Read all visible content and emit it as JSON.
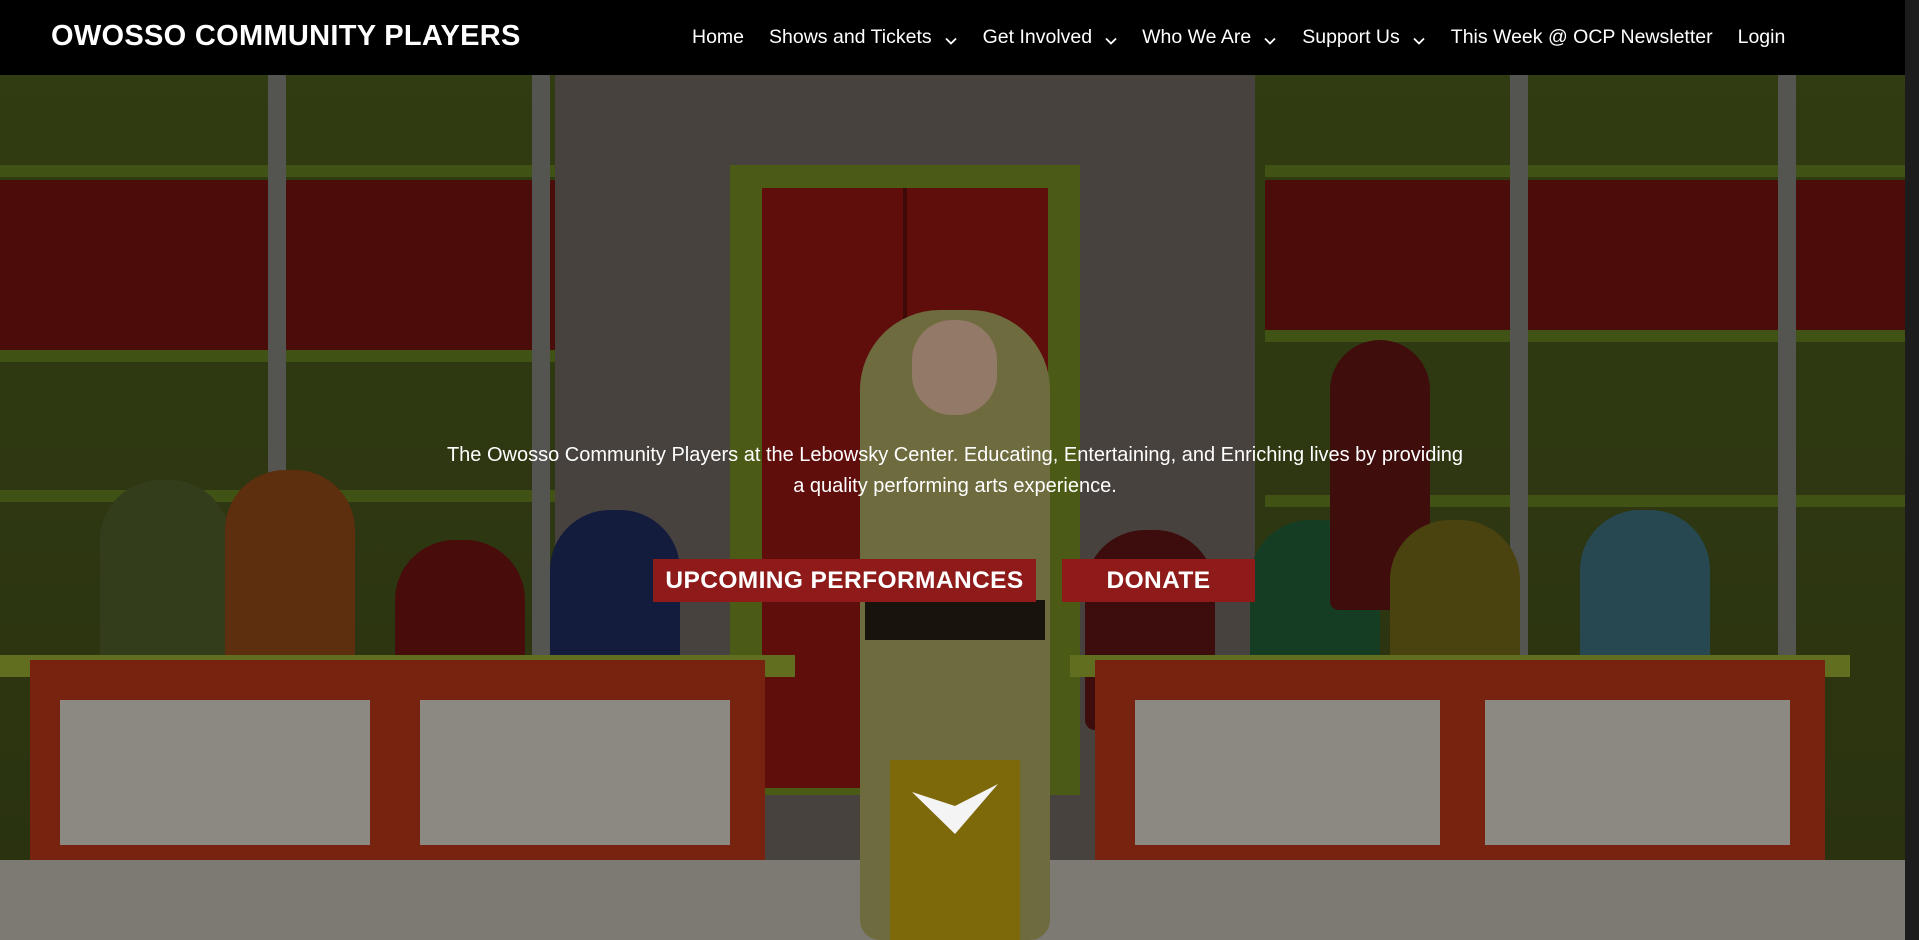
{
  "site": {
    "title": "OWOSSO COMMUNITY PLAYERS"
  },
  "nav": {
    "items": [
      {
        "label": "Home",
        "has_dropdown": false
      },
      {
        "label": "Shows and Tickets",
        "has_dropdown": true
      },
      {
        "label": "Get Involved",
        "has_dropdown": true
      },
      {
        "label": "Who We Are",
        "has_dropdown": true
      },
      {
        "label": "Support Us",
        "has_dropdown": true
      },
      {
        "label": "This Week @ OCP Newsletter",
        "has_dropdown": false
      },
      {
        "label": "Login",
        "has_dropdown": false
      }
    ],
    "icon": "chevron-down-icon"
  },
  "hero": {
    "tagline": "The Owosso Community Players at the Lebowsky Center. Educating, Entertaining, and Enriching lives by providing a quality performing arts experience.",
    "buttons": {
      "upcoming": "UPCOMING PERFORMANCES",
      "donate": "DONATE"
    },
    "scroll_icon": "chevron-down-icon"
  },
  "colors": {
    "header_bg": "#000000",
    "button_bg": "#8e1a1a",
    "text": "#ffffff"
  }
}
